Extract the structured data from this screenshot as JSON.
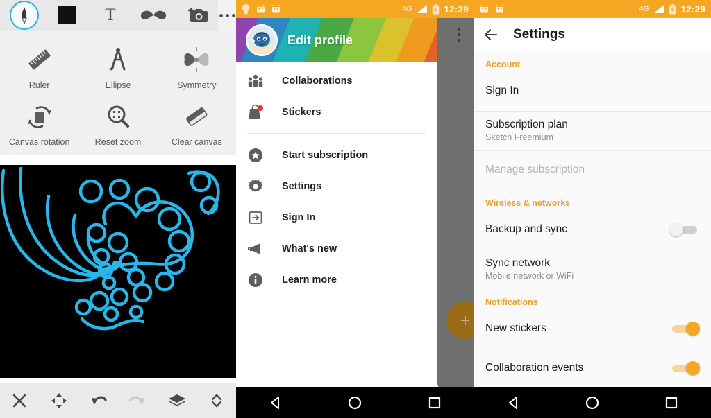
{
  "panel_draw": {
    "toolbar": {
      "brush_tool": "brush-tool",
      "color_swatch": "black",
      "text_tool": "T",
      "sticker_tool": "moustache-sticker",
      "camera_tool": "add-photo",
      "overflow": "more-options"
    },
    "tools": [
      {
        "label": "Ruler",
        "icon": "ruler-icon"
      },
      {
        "label": "Ellipse",
        "icon": "compass-icon"
      },
      {
        "label": "Symmetry",
        "icon": "butterfly-symmetry-icon"
      },
      {
        "label": "Canvas rotation",
        "icon": "rotate-icon"
      },
      {
        "label": "Reset zoom",
        "icon": "magnifier-fit-icon"
      },
      {
        "label": "Clear canvas",
        "icon": "eraser-icon"
      }
    ],
    "canvas": {
      "background": "#000000",
      "stroke_color": "#29b6e8",
      "description": "cyan looped spiral doodle"
    },
    "bottom_actions": [
      {
        "name": "close",
        "icon": "close-icon",
        "enabled": true
      },
      {
        "name": "move",
        "icon": "move-arrows-icon",
        "enabled": true
      },
      {
        "name": "undo",
        "icon": "undo-icon",
        "enabled": true
      },
      {
        "name": "redo",
        "icon": "redo-icon",
        "enabled": false
      },
      {
        "name": "layers",
        "icon": "layers-icon",
        "enabled": true
      },
      {
        "name": "expand",
        "icon": "chevron-up-down-icon",
        "enabled": true
      }
    ]
  },
  "status_bar": {
    "network": "4G",
    "clock": "12:29",
    "background": "#F5A623",
    "notifications": [
      "bulb-icon",
      "android-icon",
      "android-icon"
    ]
  },
  "panel_drawer": {
    "header": {
      "title": "Edit profile",
      "avatar": "user-avatar",
      "stripe_colors": [
        "#8e44ad",
        "#2e86c1",
        "#1eb3b0",
        "#4aa845",
        "#8cc63e",
        "#d9c22b",
        "#ef9b20",
        "#e2622a",
        "#c8432a"
      ]
    },
    "items_top": [
      {
        "label": "Collaborations",
        "icon": "people-icon",
        "badge": false
      },
      {
        "label": "Stickers",
        "icon": "shopping-bag-icon",
        "badge": true
      }
    ],
    "items_bottom": [
      {
        "label": "Start subscription",
        "icon": "star-badge-icon"
      },
      {
        "label": "Settings",
        "icon": "gear-icon"
      },
      {
        "label": "Sign In",
        "icon": "sign-in-icon"
      },
      {
        "label": "What's new",
        "icon": "megaphone-icon"
      },
      {
        "label": "Learn more",
        "icon": "info-icon"
      }
    ],
    "behind": {
      "overflow": "more-options",
      "fab": "+"
    }
  },
  "panel_settings": {
    "appbar": {
      "back": "back-arrow-icon",
      "title": "Settings"
    },
    "sections": [
      {
        "header": "Account",
        "rows": [
          {
            "title": "Sign In",
            "subtitle": "",
            "control": "none",
            "dim": false
          },
          {
            "title": "Subscription plan",
            "subtitle": "Sketch Freemium",
            "control": "none",
            "dim": false
          },
          {
            "title": "Manage subscription",
            "subtitle": "",
            "control": "none",
            "dim": true
          }
        ]
      },
      {
        "header": "Wireless & networks",
        "rows": [
          {
            "title": "Backup and sync",
            "subtitle": "",
            "control": "toggle-off",
            "dim": false
          },
          {
            "title": "Sync network",
            "subtitle": "Mobile network or WiFi",
            "control": "none",
            "dim": false
          }
        ]
      },
      {
        "header": "Notifications",
        "rows": [
          {
            "title": "New stickers",
            "subtitle": "",
            "control": "toggle-on",
            "dim": false
          },
          {
            "title": "Collaboration events",
            "subtitle": "",
            "control": "toggle-on",
            "dim": false
          }
        ]
      }
    ],
    "accent_color": "#F0A030"
  },
  "nav_bar": {
    "back": "back-triangle-icon",
    "home": "home-circle-icon",
    "recents": "recents-square-icon"
  }
}
